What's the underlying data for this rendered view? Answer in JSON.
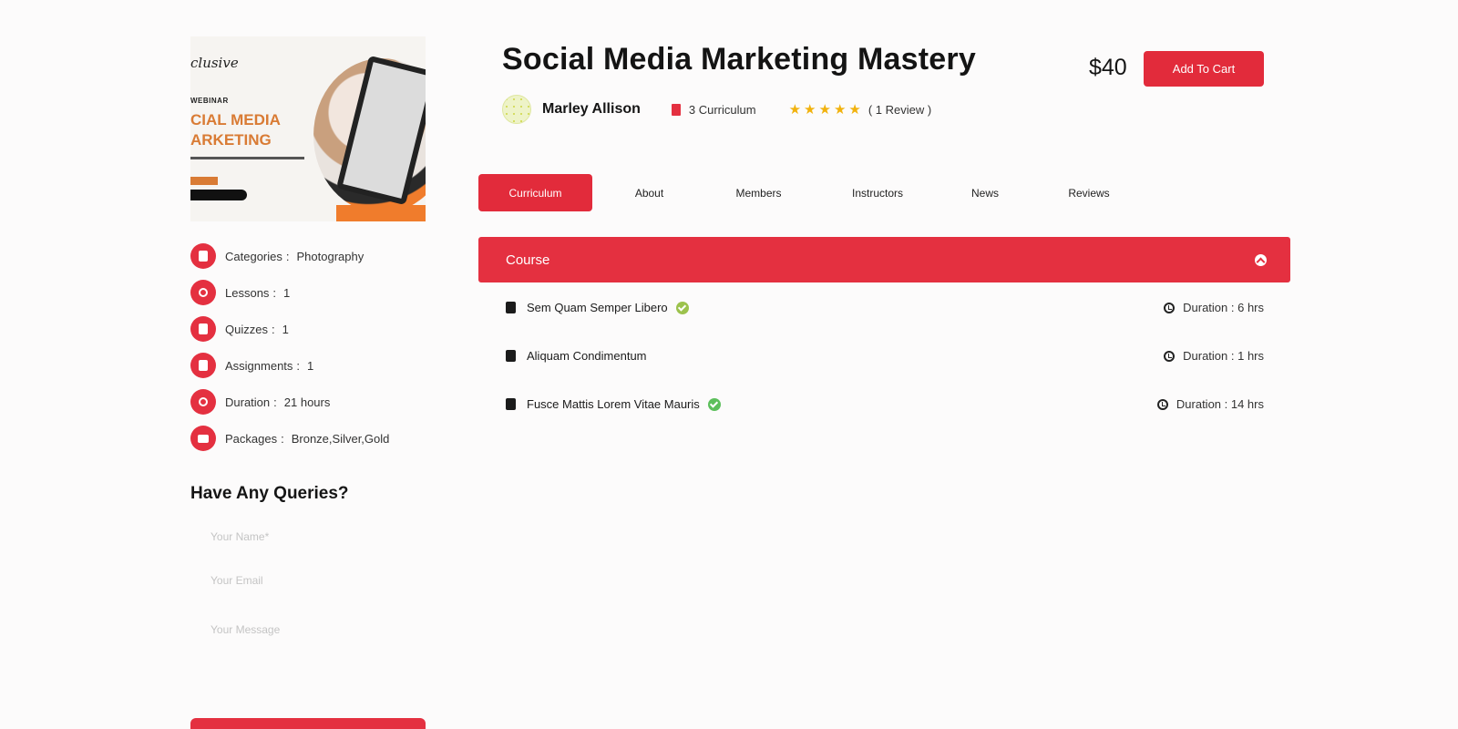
{
  "course": {
    "title": "Social Media Marketing Mastery",
    "price": "$40",
    "add_to_cart": "Add To Cart",
    "author": "Marley Allison",
    "curriculum_count": "3 Curriculum",
    "rating_stars": 5,
    "review_text": "( 1 Review )"
  },
  "thumbnail": {
    "brand_text": "clusive",
    "webinar_label": "WEBINAR",
    "headline_line1": "CIAL MEDIA",
    "headline_line2": "ARKETING"
  },
  "meta": [
    {
      "label": "Categories",
      "sep": ":",
      "value": "Photography",
      "icon": "category-icon"
    },
    {
      "label": "Lessons",
      "sep": ":",
      "value": "1",
      "icon": "lessons-icon"
    },
    {
      "label": "Quizzes",
      "sep": ":",
      "value": "1",
      "icon": "quizzes-icon"
    },
    {
      "label": "Assignments",
      "sep": ":",
      "value": "1",
      "icon": "assignments-icon"
    },
    {
      "label": "Duration",
      "sep": ":",
      "value": "21 hours",
      "icon": "duration-icon"
    },
    {
      "label": "Packages",
      "sep": ":",
      "value": "Bronze,Silver,Gold",
      "icon": "packages-icon"
    }
  ],
  "queries": {
    "title": "Have Any Queries?",
    "name_placeholder": "Your Name*",
    "email_placeholder": "Your Email",
    "message_placeholder": "Your Message"
  },
  "tabs": [
    {
      "label": "Curriculum",
      "active": true
    },
    {
      "label": "About"
    },
    {
      "label": "Members"
    },
    {
      "label": "Instructors"
    },
    {
      "label": "News"
    },
    {
      "label": "Reviews"
    }
  ],
  "accordion": {
    "title": "Course",
    "expanded": true,
    "lessons": [
      {
        "title": "Sem Quam Semper Libero",
        "duration": "Duration : 6 hrs",
        "icon": "quiz-icon",
        "badge": "check-badge-icon"
      },
      {
        "title": "Aliquam Condimentum",
        "duration": "Duration : 1 hrs",
        "icon": "document-icon"
      },
      {
        "title": "Fusce Mattis Lorem Vitae Mauris",
        "duration": "Duration : 14 hrs",
        "icon": "book-icon",
        "badge": "check-badge-icon"
      }
    ]
  },
  "colors": {
    "accent": "#e43040",
    "star": "#f1b20d",
    "check": "#5cbf5b",
    "background": "#fcfbfb"
  }
}
